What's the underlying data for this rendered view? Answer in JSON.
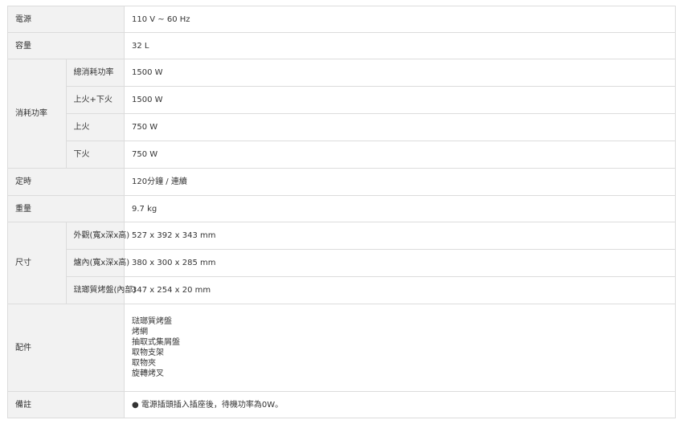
{
  "spec": {
    "power": {
      "label": "電源",
      "value": "110 V ~ 60 Hz"
    },
    "capacity": {
      "label": "容量",
      "value": "32 L"
    },
    "consumption": {
      "label": "消耗功率",
      "rows": [
        {
          "label": "總消耗功率",
          "value": "1500 W"
        },
        {
          "label": "上火+下火",
          "value": "1500 W"
        },
        {
          "label": "上火",
          "value": "750 W"
        },
        {
          "label": "下火",
          "value": "750 W"
        }
      ]
    },
    "timer": {
      "label": "定時",
      "value": "120分鐘 / 連續"
    },
    "weight": {
      "label": "重量",
      "value": "9.7 kg"
    },
    "dimensions": {
      "label": "尺寸",
      "rows": [
        {
          "label": "外觀(寬x深x高)",
          "value": "527 x 392 x 343 mm"
        },
        {
          "label": "爐內(寬x深x高)",
          "value": "380 x 300 x 285 mm"
        },
        {
          "label": "琺瑯質烤盤(內部)",
          "value": "347 x 254 x 20 mm"
        }
      ]
    },
    "accessories": {
      "label": "配件",
      "items": [
        "琺瑯質烤盤",
        "烤網",
        "抽取式集屑盤",
        "取物支架",
        "取物夾",
        "旋轉烤叉"
      ]
    },
    "remarks": {
      "label": "備註",
      "value": "● 電源插頭插入插座後，待機功率為0W。"
    }
  }
}
